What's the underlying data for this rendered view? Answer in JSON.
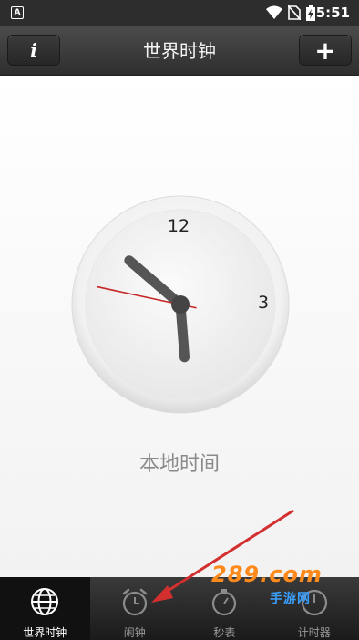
{
  "status_bar": {
    "notification_icon": "A",
    "time": "5:51",
    "icons": [
      "wifi-icon",
      "no-sim-icon",
      "battery-charging-icon"
    ]
  },
  "header": {
    "title": "世界时钟",
    "left_button_icon": "info-icon",
    "left_button_label": "i",
    "right_button_icon": "add-icon",
    "right_button_label": "+"
  },
  "clock": {
    "number_12": "12",
    "number_3": "3",
    "hour": 5,
    "minute": 51,
    "second": 47,
    "caption": "本地时间"
  },
  "tabs": [
    {
      "label": "世界时钟",
      "icon": "globe-icon",
      "active": true
    },
    {
      "label": "闹钟",
      "icon": "alarm-clock-icon",
      "active": false
    },
    {
      "label": "秒表",
      "icon": "stopwatch-icon",
      "active": false
    },
    {
      "label": "计时器",
      "icon": "timer-icon",
      "active": false
    }
  ],
  "watermark": {
    "main": "289.com",
    "sub": "手游网"
  },
  "colors": {
    "accent_red": "#d32f2f",
    "title_bar": "#3a3a3a"
  }
}
